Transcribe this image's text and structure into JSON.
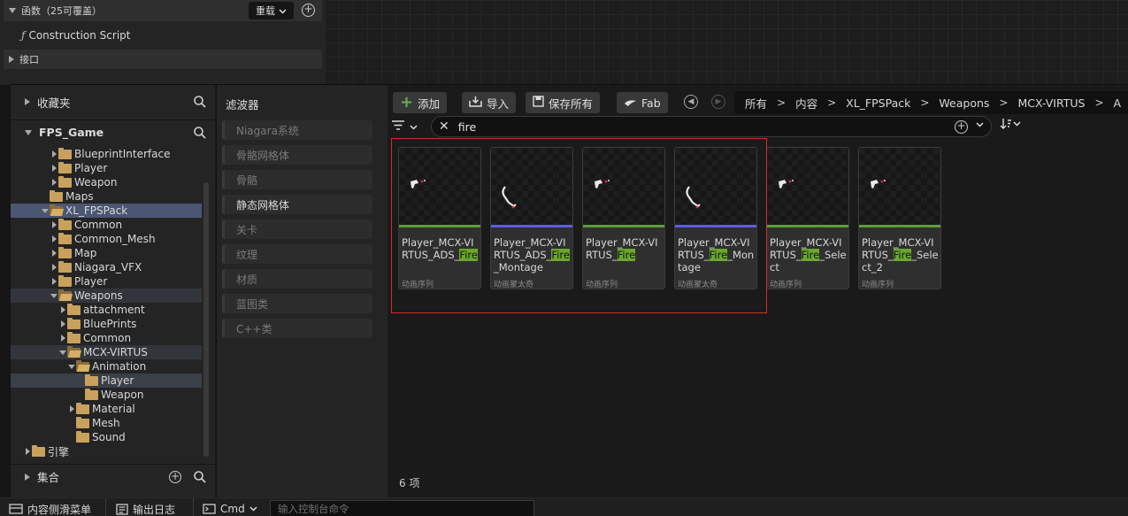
{
  "blueprint_panel": {
    "functions_label": "函数（25可覆盖）",
    "override_label": "重载",
    "construction_script": "Construction Script",
    "interface_label": "接口"
  },
  "sources": {
    "favorites_label": "收藏夹",
    "project_label": "FPS_Game",
    "collections_label": "集合",
    "tree": [
      {
        "name": "BlueprintInterface",
        "expanded": false,
        "indent": 1
      },
      {
        "name": "Player",
        "expanded": false,
        "indent": 1
      },
      {
        "name": "Weapon",
        "expanded": false,
        "indent": 1
      },
      {
        "name": "Maps",
        "expanded": false,
        "indent": 0
      },
      {
        "name": "XL_FPSPack",
        "expanded": true,
        "indent": 0
      },
      {
        "name": "Common",
        "expanded": false,
        "indent": 1
      },
      {
        "name": "Common_Mesh",
        "expanded": false,
        "indent": 1
      },
      {
        "name": "Map",
        "expanded": false,
        "indent": 1
      },
      {
        "name": "Niagara_VFX",
        "expanded": false,
        "indent": 1
      },
      {
        "name": "Player",
        "expanded": false,
        "indent": 1
      },
      {
        "name": "Weapons",
        "expanded": true,
        "indent": 1
      },
      {
        "name": "attachment",
        "expanded": false,
        "indent": 2
      },
      {
        "name": "BluePrints",
        "expanded": false,
        "indent": 2
      },
      {
        "name": "Common",
        "expanded": false,
        "indent": 2
      },
      {
        "name": "MCX-VIRTUS",
        "expanded": true,
        "indent": 2
      },
      {
        "name": "Animation",
        "expanded": true,
        "indent": 3
      },
      {
        "name": "Player",
        "expanded": false,
        "indent": 4
      },
      {
        "name": "Weapon",
        "expanded": false,
        "indent": 4
      },
      {
        "name": "Material",
        "expanded": false,
        "indent": 3
      },
      {
        "name": "Mesh",
        "expanded": false,
        "indent": 3
      },
      {
        "name": "Sound",
        "expanded": false,
        "indent": 3
      },
      {
        "name": "引擎",
        "expanded": false,
        "indent": -1
      }
    ]
  },
  "filters": {
    "title": "滤波器",
    "items": [
      "Niagara系统",
      "骨骼网格体",
      "骨骼",
      "静态网格体",
      "关卡",
      "纹理",
      "材质",
      "蓝图类",
      "C++类"
    ],
    "active_index": 3
  },
  "toolbar": {
    "add_label": "添加",
    "import_label": "导入",
    "save_all_label": "保存所有",
    "fab_label": "Fab"
  },
  "breadcrumb": [
    "所有",
    "内容",
    "XL_FPSPack",
    "Weapons",
    "MCX-VIRTUS",
    "A"
  ],
  "search": {
    "value": "fire"
  },
  "assets": [
    {
      "pre": "Player_MCX-VIRTUS_ADS_",
      "match": "Fire",
      "post": "",
      "type": "动画序列"
    },
    {
      "pre": "Player_MCX-VIRTUS_ADS_",
      "match": "Fire",
      "post": "_Montage",
      "type": "动画蒙太奇"
    },
    {
      "pre": "Player_MCX-VIRTUS_",
      "match": "Fire",
      "post": "",
      "type": "动画序列"
    },
    {
      "pre": "Player_MCX-VIRTUS_",
      "match": "Fire",
      "post": "_Montage",
      "type": "动画蒙太奇"
    },
    {
      "pre": "Player_MCX-VIRTUS_",
      "match": "Fire",
      "post": "_Select",
      "type": "动画序列"
    },
    {
      "pre": "Player_MCX-VIRTUS_",
      "match": "Fire",
      "post": "_Select_2",
      "type": "动画序列"
    }
  ],
  "item_count": "6 项",
  "statusbar": {
    "drawer_label": "内容侧滑菜单",
    "output_log_label": "输出日志",
    "cmd_label": "Cmd",
    "cmd_placeholder": "输入控制台命令"
  },
  "colors": {
    "accent_green": "#6aa82c",
    "selection_red": "#d32b2b",
    "montage_blue": "#5c5ce0"
  }
}
